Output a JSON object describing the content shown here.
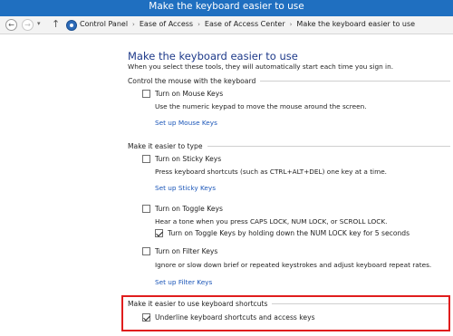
{
  "window": {
    "title": "Make the keyboard easier to use"
  },
  "nav": {
    "back_glyph": "←",
    "forward_glyph": "→",
    "history_glyph": "▾",
    "up_glyph": "↑",
    "separator": "›",
    "breadcrumb": [
      "Control Panel",
      "Ease of Access",
      "Ease of Access Center",
      "Make the keyboard easier to use"
    ]
  },
  "main": {
    "title": "Make the keyboard easier to use",
    "subtitle": "When you select these tools, they will automatically start each time you sign in.",
    "mouse_section": {
      "heading": "Control the mouse with the keyboard",
      "mouse_keys": {
        "label": "Turn on Mouse Keys",
        "checked": false
      },
      "description": "Use the numeric keypad to move the mouse around the screen.",
      "setup_link": "Set up Mouse Keys"
    },
    "typing_section": {
      "heading": "Make it easier to type",
      "sticky_keys": {
        "label": "Turn on Sticky Keys",
        "checked": false
      },
      "sticky_description": "Press keyboard shortcuts (such as CTRL+ALT+DEL) one key at a time.",
      "sticky_setup_link": "Set up Sticky Keys",
      "toggle_keys": {
        "label": "Turn on Toggle Keys",
        "checked": false
      },
      "toggle_description": "Hear a tone when you press CAPS LOCK, NUM LOCK, or SCROLL LOCK.",
      "toggle_hold": {
        "label": "Turn on Toggle Keys by holding down the NUM LOCK key for 5 seconds",
        "checked": true
      },
      "filter_keys": {
        "label": "Turn on Filter Keys",
        "checked": false
      },
      "filter_description": "Ignore or slow down brief or repeated keystrokes and adjust keyboard repeat rates.",
      "filter_setup_link": "Set up Filter Keys"
    },
    "shortcuts_section": {
      "heading": "Make it easier to use keyboard shortcuts",
      "underline": {
        "label": "Underline keyboard shortcuts and access keys",
        "checked": true
      }
    }
  },
  "colors": {
    "titlebar": "#1f6fc0",
    "link": "#1a55b8",
    "page_title": "#1e3a8a",
    "highlight": "#e01d1d"
  }
}
